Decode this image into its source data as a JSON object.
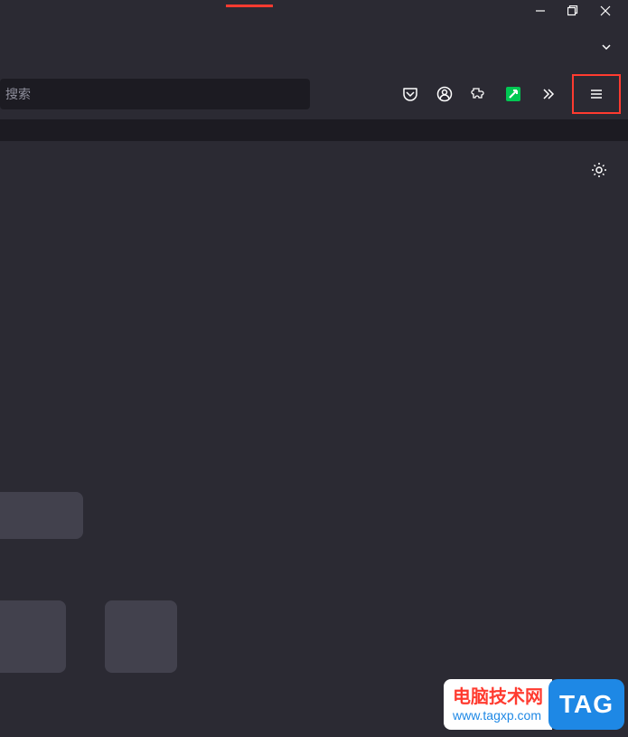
{
  "search": {
    "placeholder": "搜索"
  },
  "watermark": {
    "title": "电脑技术网",
    "url": "www.tagxp.com",
    "tag": "TAG"
  },
  "icons": {
    "pocket": "pocket-icon",
    "account": "account-icon",
    "extensions": "extensions-icon",
    "xunlei": "xunlei-icon",
    "overflow": "overflow-icon",
    "menu": "menu-icon",
    "settings": "gear-icon",
    "minimize": "minimize-icon",
    "maximize": "maximize-icon",
    "close": "close-icon",
    "chevron": "chevron-down-icon"
  }
}
